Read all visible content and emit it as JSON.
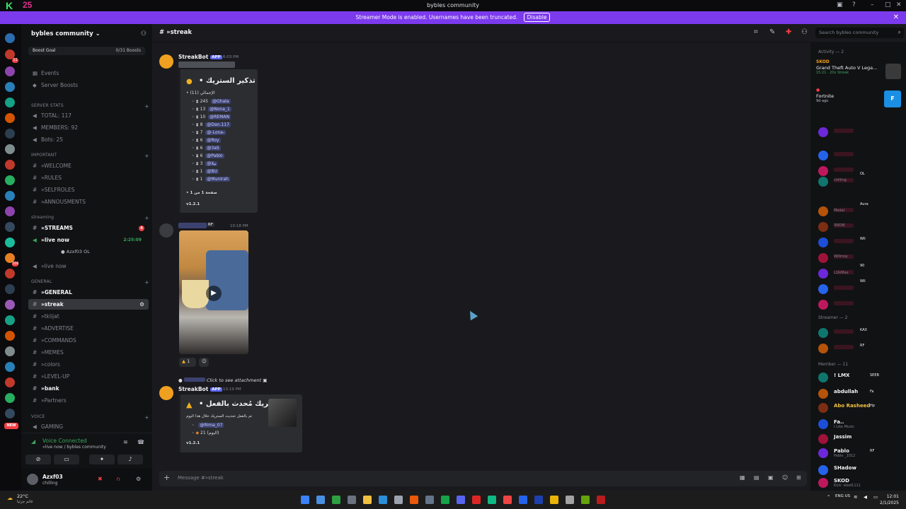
{
  "window": {
    "title": "bybles community",
    "logo_main": "K",
    "logo_num": "25"
  },
  "banner": {
    "text": "Streamer Mode is enabled. Usernames have been truncated.",
    "disable": "Disable"
  },
  "sidebar": {
    "guild_name": "bybles community",
    "boost_goal": "Boost Goal",
    "boost_count": "0/31 Boosts",
    "events": "Events",
    "server_boosts": "Server Boosts",
    "server_stats_cat": "SERVER STATS",
    "total": "TOTAL: 117",
    "members": "MEMBERS: 92",
    "bots": "Bots: 25",
    "important_cat": "IMPORTANT",
    "welcome": "»WELCOME",
    "rules": "»RULES",
    "selfroles": "»SELFROLES",
    "annousments": "»ANNOUSMENTS",
    "streaming_cat": "streaming",
    "streams": "»STREAMS",
    "streams_mentions": "4",
    "live_now": "»live now",
    "live_time": "2:25:09",
    "voice_user": "Azxf03",
    "voice_user_tag": "OL",
    "live_now2": "»live now",
    "general_cat": "GENERAL",
    "general": "»GENERAL",
    "streak": "»streak",
    "tklijat": "»tklijat",
    "advertise": "»ADVERTISE",
    "commands": "»COMMANDS",
    "memes": "»MEMES",
    "colors": "»colors",
    "levelup": "»LEVEL-UP",
    "bank": "»bank",
    "partners": "»Partners",
    "voice_cat": "VOICE",
    "gaming": "GAMING"
  },
  "voice_status": {
    "title": "Voice Connected",
    "sub": "»live now / bybles community"
  },
  "user": {
    "name": "Azxf03",
    "status": "chilling"
  },
  "channel": {
    "name": "»streak",
    "search_placeholder": "Search bybles community"
  },
  "messages": {
    "m1_author": "StreakBot",
    "m1_tag": "APP",
    "m1_time": "6:03 PM",
    "m1_title": "تذكير الستريك •",
    "m1_total": "الإجمالي (11)",
    "leaderboard": [
      {
        "score": "245",
        "user": "@Ghala"
      },
      {
        "score": "13",
        "user": "@Nona_1"
      },
      {
        "score": "10",
        "user": "@REMAN"
      },
      {
        "score": "8",
        "user": "@Dan.117"
      },
      {
        "score": "7",
        "user": "@-Lona-"
      },
      {
        "score": "6",
        "user": "@Roy"
      },
      {
        "score": "6",
        "user": "@3aS"
      },
      {
        "score": "6",
        "user": "@Pablo"
      },
      {
        "score": "3",
        "user": "@بيلا"
      },
      {
        "score": "1",
        "user": "@BU"
      },
      {
        "score": "1",
        "user": "@Munirah"
      }
    ],
    "m1_page": "صفحة 1 من 1",
    "m1_version": "v1.2.1",
    "m2_tag": "RF",
    "m2_time": "10:18 PM",
    "m2_reaction_count": "1",
    "m3_reply": "Click to see attachment",
    "m3_author": "StreakBot",
    "m3_tag": "APP",
    "m3_time": "10:19 PM",
    "m3_title": "الستريك مُحدث بالفعل •",
    "m3_desc": "تم بالفعل تحديث الستريك خلال هذا اليوم",
    "m3_user": "@Rima_07",
    "m3_streak": "21 (اليوم)",
    "m3_version": "v1.2.1",
    "composer_placeholder": "Message #»streak"
  },
  "members": {
    "activity_header": "Activity — 2",
    "act1_user": "SKOD",
    "act1_game": "Grand Theft Auto V Lega...",
    "act1_sub": "15:21 · 20x Streak",
    "act2_game": "Fortnite",
    "act2_sub": "9d ago",
    "streamer_header": "Streamer — 2",
    "streamer1_tag": "KAX",
    "streamer2_tag": "RF",
    "member_header": "Member — 11",
    "list": [
      {
        "name": "! LMX",
        "tag": "SEEB"
      },
      {
        "name": "abdullah",
        "tag": "Fa"
      },
      {
        "name": "Abo Rasheed",
        "tag": "Hp"
      },
      {
        "name": "Fa..",
        "sub": "I Like Music"
      },
      {
        "name": "Jassim"
      },
      {
        "name": "Pablo",
        "tag": "RF",
        "sub": "Pablo _1012"
      },
      {
        "name": "SHadow"
      },
      {
        "name": "SKOD",
        "sub": "Kick: skod1111"
      }
    ],
    "other_tags": [
      "OL",
      "Aura",
      "Wil",
      "90",
      "Wil",
      "6v"
    ],
    "other_subs": [
      "chilling",
      "Medal",
      "SNOW",
      "Willmoy",
      "L1lkMax"
    ]
  },
  "taskbar": {
    "temp": "22°C",
    "weather_sub": "غائم جزئيا",
    "lang": "ENG US",
    "time": "12:01",
    "date": "2/1/2025"
  },
  "colors": {
    "accent": "#7c3aed",
    "blurple": "#5865f2",
    "online": "#3ba55c",
    "danger": "#f23f43"
  }
}
